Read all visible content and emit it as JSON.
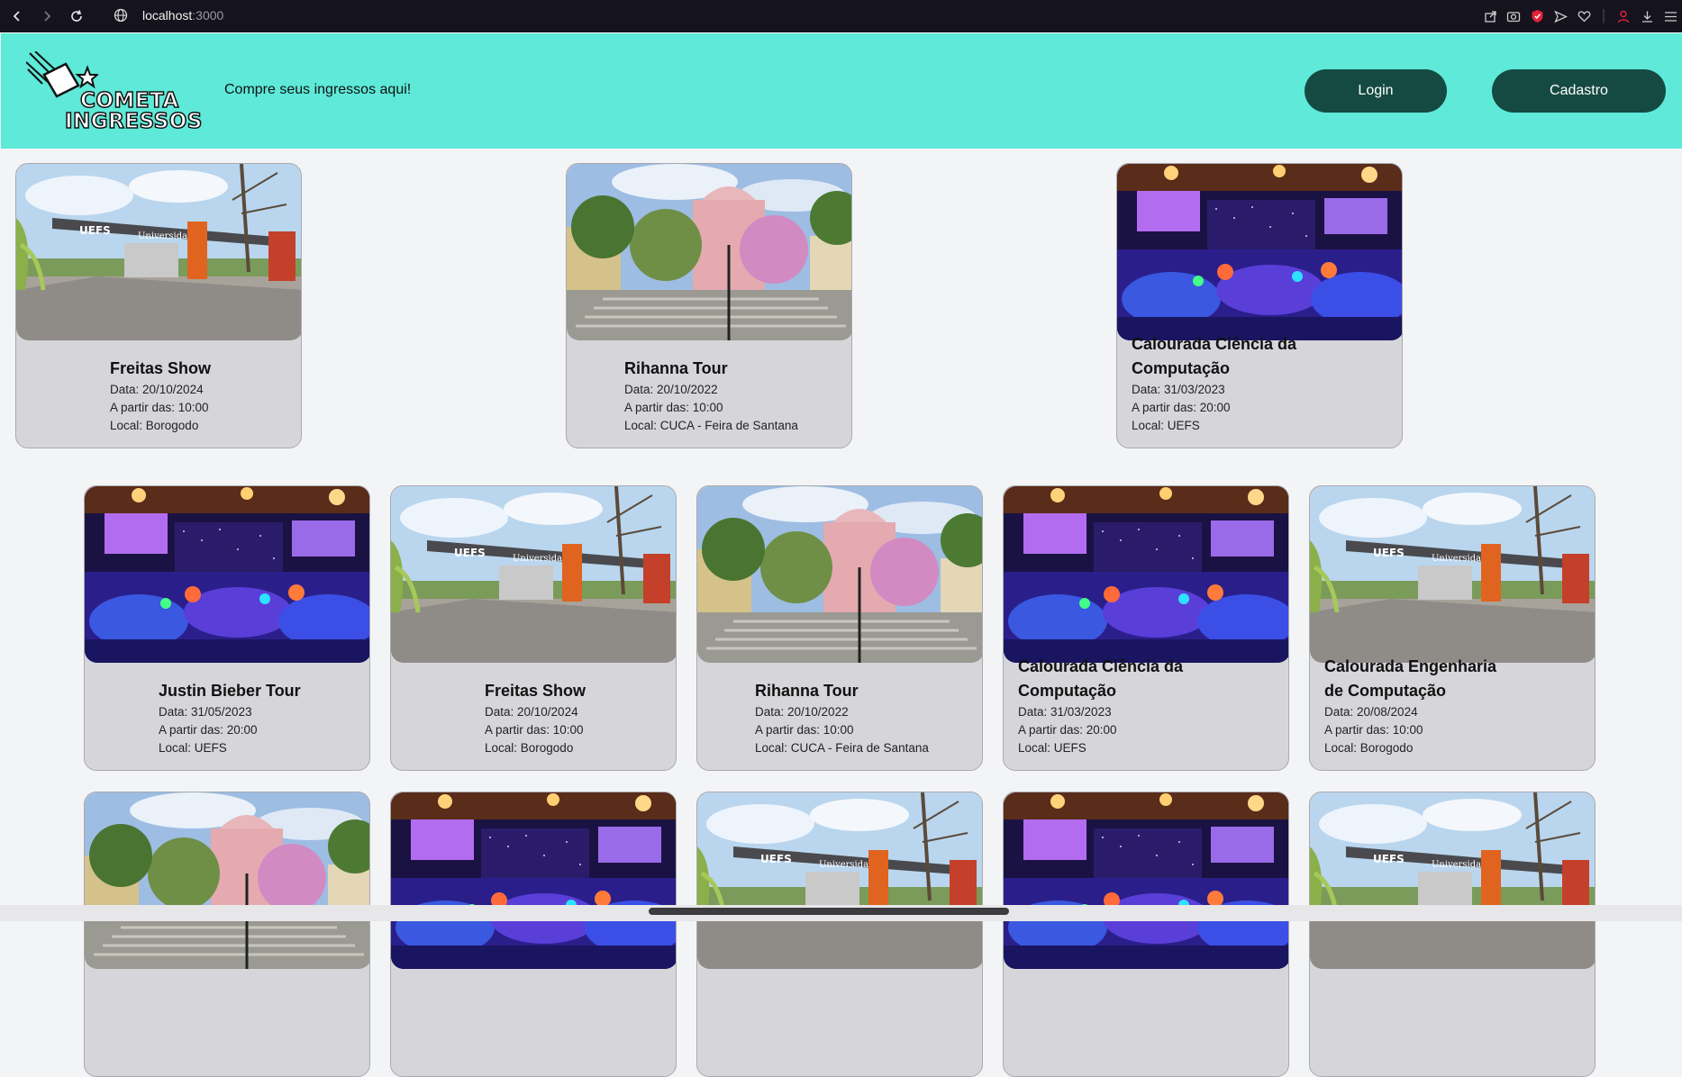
{
  "browser": {
    "url_host": "localhost",
    "url_port": ":3000"
  },
  "header": {
    "logo_line1": "COMETA",
    "logo_line2": "INGRESSOS",
    "tagline": "Compre seus ingressos aqui!",
    "login_label": "Login",
    "signup_label": "Cadastro"
  },
  "events": [
    {
      "title": "Freitas Show",
      "date": "Data: 20/10/2024",
      "time": "A partir das: 10:00",
      "place": "Local: Borogodo",
      "image": "uefs-gate"
    },
    {
      "title": "Rihanna Tour",
      "date": "Data: 20/10/2022",
      "time": "A partir das: 10:00",
      "place": "Local: CUCA - Feira de Santana",
      "image": "cuca-garden"
    },
    {
      "title": "Calourada Ciência da Computação",
      "date": "Data: 31/03/2023",
      "time": "A partir das: 20:00",
      "place": "Local: UEFS",
      "image": "party-hall"
    },
    {
      "title": "Justin Bieber Tour",
      "date": "Data: 31/05/2023",
      "time": "A partir das: 20:00",
      "place": "Local: UEFS",
      "image": "party-hall"
    },
    {
      "title": "Freitas Show",
      "date": "Data: 20/10/2024",
      "time": "A partir das: 10:00",
      "place": "Local: Borogodo",
      "image": "uefs-gate"
    },
    {
      "title": "Rihanna Tour",
      "date": "Data: 20/10/2022",
      "time": "A partir das: 10:00",
      "place": "Local: CUCA - Feira de Santana",
      "image": "cuca-garden"
    },
    {
      "title": "Calourada Ciência da Computação",
      "date": "Data: 31/03/2023",
      "time": "A partir das: 20:00",
      "place": "Local: UEFS",
      "image": "party-hall"
    },
    {
      "title": "Calourada Engenharia de Computação",
      "date": "Data: 20/08/2024",
      "time": "A partir das: 10:00",
      "place": "Local: Borogodo",
      "image": "uefs-gate"
    },
    {
      "image": "cuca-garden"
    },
    {
      "image": "party-hall"
    },
    {
      "image": "uefs-gate"
    },
    {
      "image": "party-hall"
    },
    {
      "image": "uefs-gate"
    }
  ],
  "colors": {
    "header_bg": "#5ee9d8",
    "button_bg": "#154a43",
    "card_bg": "#d6d6da",
    "page_bg": "#f3f4f6"
  }
}
